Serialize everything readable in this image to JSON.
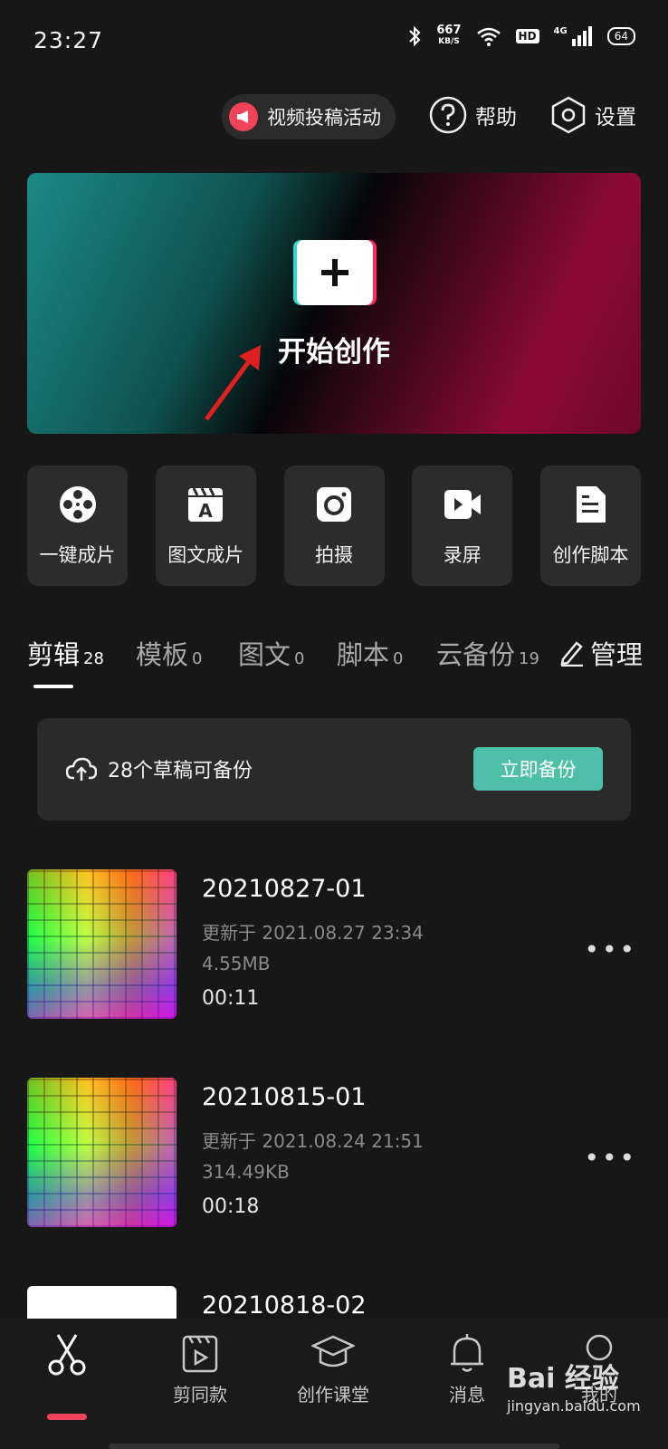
{
  "status_bar": {
    "time": "23:27",
    "net_speed": "667",
    "net_unit": "KB/S",
    "hd": "HD",
    "signal": "4G",
    "battery": "64"
  },
  "top_actions": {
    "promo": "视频投稿活动",
    "help": "帮助",
    "settings": "设置"
  },
  "banner": {
    "label": "开始创作"
  },
  "quick_actions": [
    {
      "label": "一键成片",
      "icon": "film-reel-icon"
    },
    {
      "label": "图文成片",
      "icon": "text-clapper-icon"
    },
    {
      "label": "拍摄",
      "icon": "camera-icon"
    },
    {
      "label": "录屏",
      "icon": "video-camera-icon"
    },
    {
      "label": "创作脚本",
      "icon": "script-document-icon"
    }
  ],
  "tabs": [
    {
      "label": "剪辑",
      "count": "28"
    },
    {
      "label": "模板",
      "count": "0"
    },
    {
      "label": "图文",
      "count": "0"
    },
    {
      "label": "脚本",
      "count": "0"
    },
    {
      "label": "云备份",
      "count": "19"
    }
  ],
  "manage": "管理",
  "backup": {
    "text": "28个草稿可备份",
    "button": "立即备份"
  },
  "drafts": [
    {
      "title": "20210827-01",
      "updated": "更新于 2021.08.27 23:34",
      "size": "4.55MB",
      "duration": "00:11"
    },
    {
      "title": "20210815-01",
      "updated": "更新于 2021.08.24 21:51",
      "size": "314.49KB",
      "duration": "00:18"
    },
    {
      "title": "20210818-02"
    }
  ],
  "bottom_nav": [
    {
      "label": "",
      "icon": "scissors-icon"
    },
    {
      "label": "剪同款",
      "icon": "template-icon"
    },
    {
      "label": "创作课堂",
      "icon": "graduation-cap-icon"
    },
    {
      "label": "消息",
      "icon": "bell-icon"
    },
    {
      "label": "我的",
      "icon": "profile-icon"
    }
  ],
  "watermark": {
    "brand": "Bai 经验",
    "url": "jingyan.baidu.com"
  },
  "colors": {
    "accent": "#4ec0aa",
    "active_tab": "#f2435e",
    "background": "#171717"
  }
}
